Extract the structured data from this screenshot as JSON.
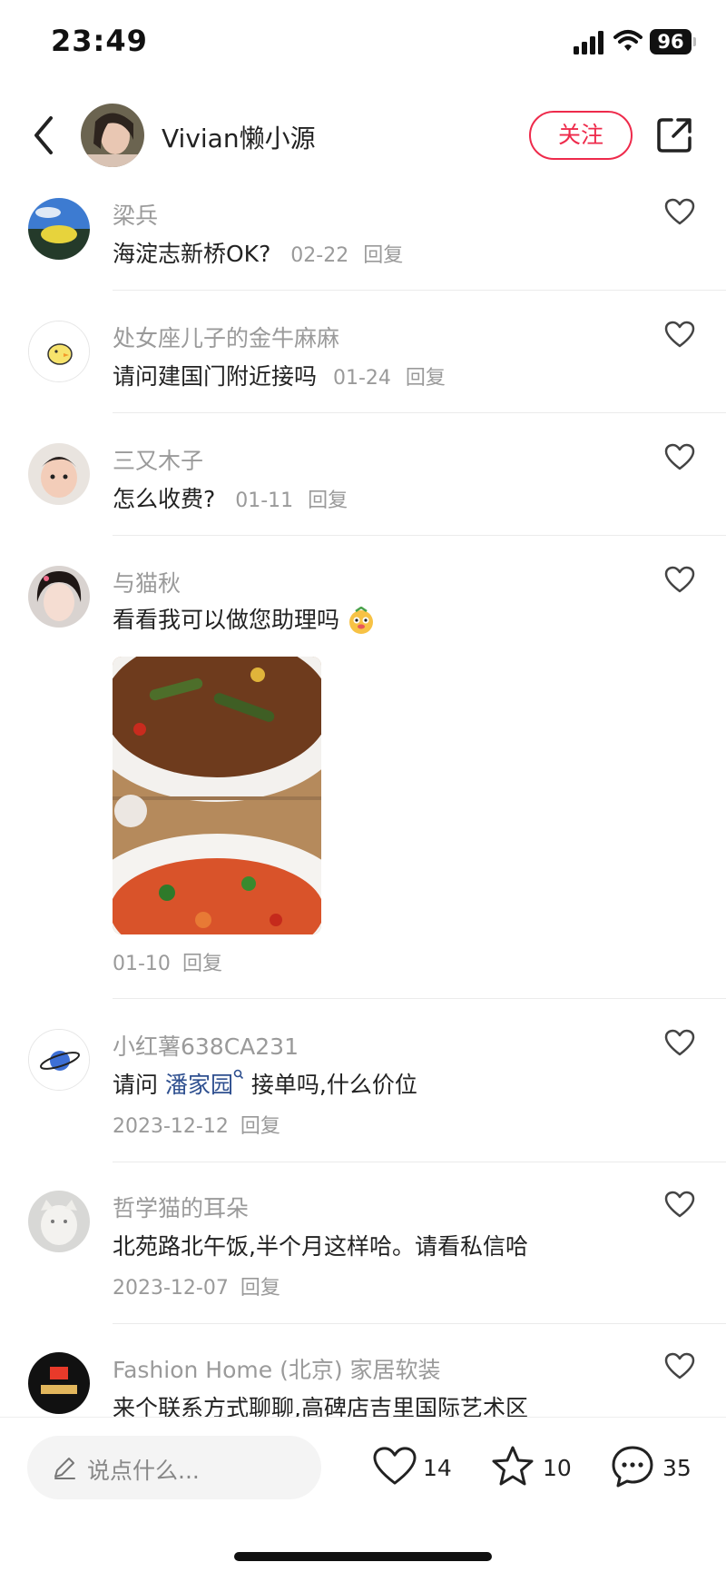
{
  "status_bar": {
    "time": "23:49",
    "battery": "96"
  },
  "header": {
    "author_name": "Vivian懒小源",
    "follow_label": "关注"
  },
  "comments": [
    {
      "name": "梁兵",
      "text": "海淀志新桥OK?",
      "date": "02-22",
      "reply": "回复"
    },
    {
      "name": "处女座儿子的金牛麻麻",
      "text": "请问建国门附近接吗",
      "date": "01-24",
      "reply": "回复"
    },
    {
      "name": "三又木子",
      "text": "怎么收费?",
      "date": "01-11",
      "reply": "回复"
    },
    {
      "name": "与猫秋",
      "text": "看看我可以做您助理吗",
      "date": "01-10",
      "reply": "回复"
    },
    {
      "name": "小红薯638CA231",
      "text_before": "请问 ",
      "link": "潘家园",
      "text_after": " 接单吗,什么价位",
      "date": "2023-12-12",
      "reply": "回复"
    },
    {
      "name": "哲学猫的耳朵",
      "text": "北苑路北午饭,半个月这样哈。请看私信哈",
      "date": "2023-12-07",
      "reply": "回复"
    },
    {
      "name": "Fashion Home (北京) 家居软装",
      "text": "来个联系方式聊聊,高碑店吉里国际艺术区"
    }
  ],
  "bottom_bar": {
    "input_placeholder": "说点什么...",
    "likes": "14",
    "favorites": "10",
    "comments": "35"
  },
  "colors": {
    "accent": "#ee2a4b",
    "link": "#2e4f8f",
    "meta": "#9a9a9a"
  },
  "icons": [
    "back-icon",
    "share-icon",
    "heart-icon",
    "star-icon",
    "chat-icon",
    "pen-icon",
    "search-link-icon",
    "signal-icon",
    "wifi-icon",
    "battery-icon"
  ]
}
